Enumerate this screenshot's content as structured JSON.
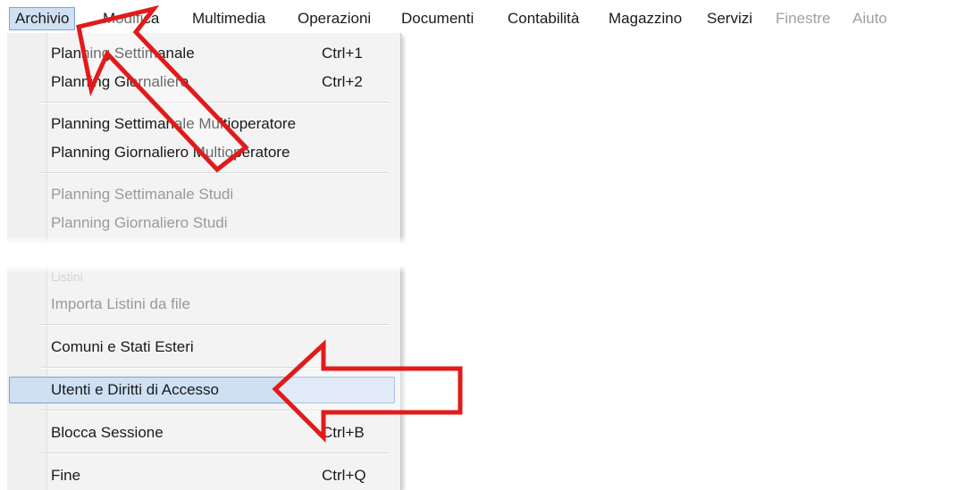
{
  "menubar": {
    "items": [
      {
        "label": "Archivio",
        "enabled": true,
        "active": true
      },
      {
        "label": "Modifica",
        "enabled": true
      },
      {
        "label": "Multimedia",
        "enabled": true
      },
      {
        "label": "Operazioni",
        "enabled": true
      },
      {
        "label": "Documenti",
        "enabled": true
      },
      {
        "label": "Contabilità",
        "enabled": true
      },
      {
        "label": "Magazzino",
        "enabled": true
      },
      {
        "label": "Servizi",
        "enabled": true
      },
      {
        "label": "Finestre",
        "enabled": false
      },
      {
        "label": "Aiuto",
        "enabled": false
      }
    ]
  },
  "dropdown": {
    "items": [
      {
        "label": "Planning Settimanale",
        "shortcut": "Ctrl+1",
        "enabled": true
      },
      {
        "label": "Planning Giornaliero",
        "shortcut": "Ctrl+2",
        "enabled": true
      },
      {
        "label": "Planning Settimanale Multioperatore",
        "enabled": true
      },
      {
        "label": "Planning Giornaliero Multioperatore",
        "enabled": true
      },
      {
        "label": "Planning Settimanale Studi",
        "enabled": false
      },
      {
        "label": "Planning Giornaliero Studi",
        "enabled": false
      },
      {
        "label": "Listini",
        "enabled": false
      },
      {
        "label": "Importa Listini da file",
        "enabled": false
      },
      {
        "label": "Comuni e Stati Esteri",
        "enabled": true
      },
      {
        "label": "Utenti e Diritti di Accesso",
        "enabled": true,
        "highlighted": true
      },
      {
        "label": "Blocca Sessione",
        "shortcut": "Ctrl+B",
        "enabled": true
      },
      {
        "label": "Fine",
        "shortcut": "Ctrl+Q",
        "enabled": true
      }
    ]
  },
  "annotations": {
    "arrow_color": "#e21a1a"
  }
}
